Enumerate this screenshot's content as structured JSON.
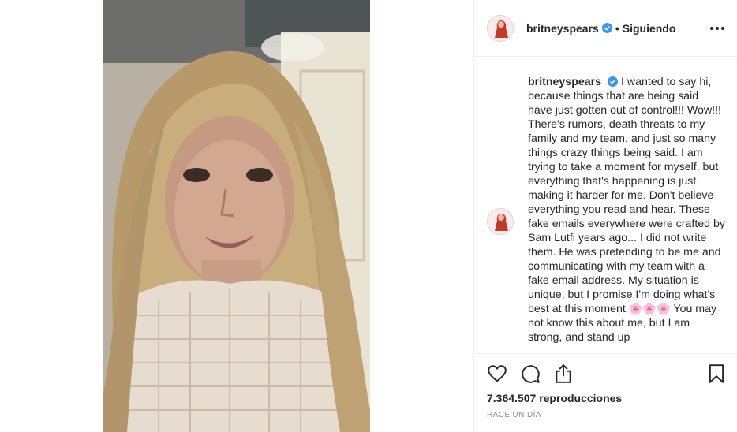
{
  "post": {
    "username": "britneyspears",
    "separator": "•",
    "follow_status": "Siguiendo",
    "verified_icon": "verified-badge-icon"
  },
  "caption": {
    "username": "britneyspears",
    "text": "I wanted to say hi, because things that are being said have just gotten out of control!!! Wow!!! There's rumors, death threats to my family and my team, and just so many things crazy things being said. I am trying to take a moment for myself, but everything that's happening is just making it harder for me. Don't believe everything you read and hear. These fake emails everywhere were crafted by Sam Lutfi years ago... I did not write them. He was pretending to be me and communicating with my team with a fake email address. My situation is unique, but I promise I'm doing what's best at this moment 🌸🌸🌸 You may not know this about me, but I am strong, and stand up"
  },
  "stats": {
    "views_count": "7.364.507",
    "views_label": "reproducciones",
    "timestamp": "HACE UN DÍA"
  },
  "icons": {
    "like": "heart-icon",
    "comment": "comment-icon",
    "share": "share-icon",
    "save": "bookmark-icon",
    "more": "more-options-icon"
  },
  "colors": {
    "verified_blue": "#3897f0",
    "text": "#262626",
    "muted": "#8e8e8e",
    "border": "#efefef"
  }
}
